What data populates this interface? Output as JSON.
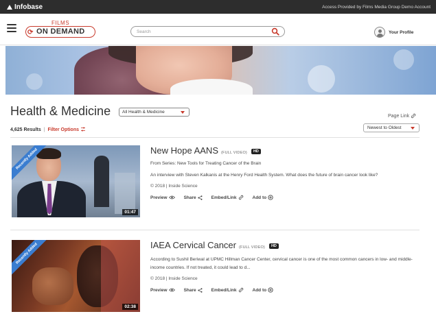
{
  "topbar": {
    "brand": "Infobase",
    "access": "Access Provided by Films Media Group Demo Account"
  },
  "header": {
    "logo_films": "FILMS",
    "logo_on_demand": "ON DEMAND",
    "search_placeholder": "Search",
    "profile_label": "Your Profile"
  },
  "page": {
    "title": "Health & Medicine",
    "category_select": "All Health & Medicine",
    "page_link": "Page Link",
    "results_count": "4,625 Results",
    "results_separator": "|",
    "filter_options": "Filter Options",
    "sort_select": "Newest to Oldest"
  },
  "colors": {
    "accent": "#c8392b",
    "topbar": "#2d2d2d",
    "badge": "#3a7dd0"
  },
  "icons": {
    "menu": "hamburger-icon",
    "search": "magnifier-icon",
    "profile": "avatar-icon",
    "link": "chain-link-icon",
    "filter": "sliders-icon",
    "preview": "eye-icon",
    "share": "share-icon",
    "embed": "chain-link-icon",
    "add": "plus-circle-icon"
  },
  "videos": [
    {
      "badge": "Recently Added",
      "duration": "01:47",
      "title": "New Hope AANS",
      "tag": "(FULL VIDEO)",
      "hd": "HD",
      "series": "From Series: New Tools for Treating Cancer of the Brain",
      "description": "An interview with Steven Kalkanis at the Henry Ford Health System. What does the future of brain cancer look like?",
      "meta": "© 2018 | Inside Science",
      "actions": {
        "preview": "Preview",
        "share": "Share",
        "embed": "Embed/Link",
        "add": "Add to"
      }
    },
    {
      "badge": "Recently Added",
      "duration": "02:38",
      "title": "IAEA Cervical Cancer",
      "tag": "(FULL VIDEO)",
      "hd": "HD",
      "series": "",
      "description": "According to Sushil Beriwal at UPMC Hillman Cancer Center, cervical cancer is one of the most common cancers in low- and middle-income countries. If not treated, it could lead to d...",
      "meta": "© 2018 | Inside Science",
      "actions": {
        "preview": "Preview",
        "share": "Share",
        "embed": "Embed/Link",
        "add": "Add to"
      }
    }
  ]
}
